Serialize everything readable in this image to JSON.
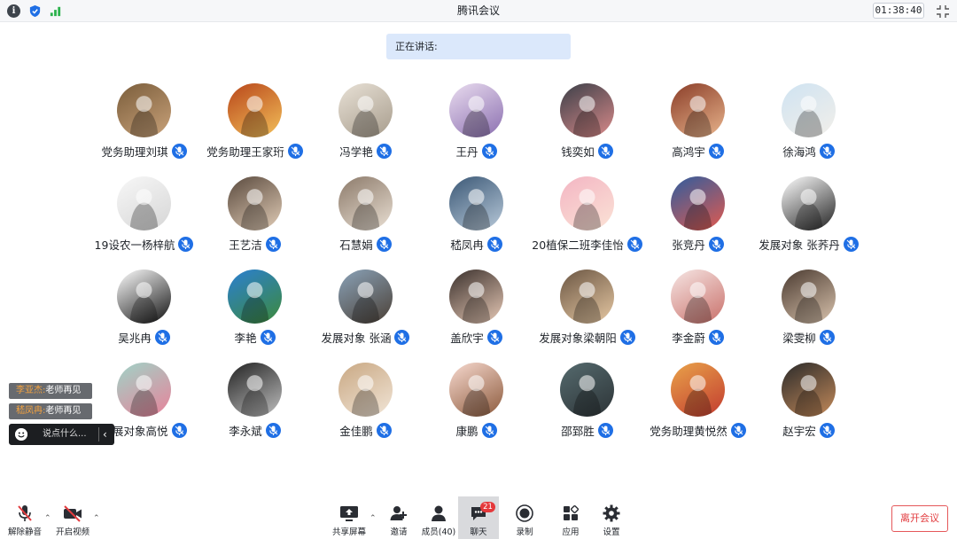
{
  "titlebar": {
    "title": "腾讯会议",
    "timer": "01:38:40",
    "icons": [
      "info-icon",
      "shield-icon",
      "signal-icon",
      "fullscreen-icon"
    ]
  },
  "speaking": {
    "label": "正在讲话:"
  },
  "participants": [
    {
      "name": "党务助理刘琪",
      "c1": "#7a5d3b",
      "c2": "#c9a27a"
    },
    {
      "name": "党务助理王家珩",
      "c1": "#b8461a",
      "c2": "#f3c05a"
    },
    {
      "name": "冯学艳",
      "c1": "#e8e1d6",
      "c2": "#a79c8c"
    },
    {
      "name": "王丹",
      "c1": "#e9dcef",
      "c2": "#8b6fb0"
    },
    {
      "name": "钱奕如",
      "c1": "#3b3f48",
      "c2": "#d98a8a"
    },
    {
      "name": "高鸿宇",
      "c1": "#8a3d28",
      "c2": "#e8b48c"
    },
    {
      "name": "徐海鸿",
      "c1": "#cfe3f2",
      "c2": "#f2efe9"
    },
    {
      "name": "19设农一杨梓航",
      "c1": "#f7f7f7",
      "c2": "#d6d6d6"
    },
    {
      "name": "王艺洁",
      "c1": "#5a4a3e",
      "c2": "#e1ccb6"
    },
    {
      "name": "石慧娟",
      "c1": "#8c7a6a",
      "c2": "#e9dfd3"
    },
    {
      "name": "嵇凤冉",
      "c1": "#3b5876",
      "c2": "#b8c9d9"
    },
    {
      "name": "20植保二班李佳怡",
      "c1": "#f3b5c3",
      "c2": "#fbe3d6"
    },
    {
      "name": "张竞丹",
      "c1": "#2f5d9e",
      "c2": "#e25a4f"
    },
    {
      "name": "发展对象 张荞丹",
      "c1": "#ffffff",
      "c2": "#222222"
    },
    {
      "name": "吴兆冉",
      "c1": "#ffffff",
      "c2": "#111111"
    },
    {
      "name": "李艳",
      "c1": "#2b7fd2",
      "c2": "#3d8a3a"
    },
    {
      "name": "发展对象 张涵",
      "c1": "#8aa2b8",
      "c2": "#4b4036"
    },
    {
      "name": "盖欣宇",
      "c1": "#3a302c",
      "c2": "#e7c9b6"
    },
    {
      "name": "发展对象梁朝阳",
      "c1": "#6b5643",
      "c2": "#e6c8a3"
    },
    {
      "name": "李金蔚",
      "c1": "#f6e6e4",
      "c2": "#c9706a"
    },
    {
      "name": "梁雯柳",
      "c1": "#4a3a30",
      "c2": "#d9c3ad"
    },
    {
      "name": "发展对象高悦",
      "c1": "#9fd3c7",
      "c2": "#e8829a"
    },
    {
      "name": "李永斌",
      "c1": "#222222",
      "c2": "#bfbfbf"
    },
    {
      "name": "金佳鹏",
      "c1": "#c9a883",
      "c2": "#f1e5d7"
    },
    {
      "name": "康鹏",
      "c1": "#f7d9cf",
      "c2": "#8c5a3c"
    },
    {
      "name": "邵郅胜",
      "c1": "#556a6e",
      "c2": "#2d3437"
    },
    {
      "name": "党务助理黄悦然",
      "c1": "#e9a34a",
      "c2": "#c23b2f"
    },
    {
      "name": "赵宇宏",
      "c1": "#2a2a2a",
      "c2": "#c48a5a"
    }
  ],
  "chat": {
    "messages": [
      {
        "sender": "李亚杰:",
        "text": "老师再见"
      },
      {
        "sender": "嵇凤冉:",
        "text": "老师再见"
      }
    ],
    "input_placeholder": "说点什么...",
    "collapse_glyph": "‹"
  },
  "toolbar": {
    "unmute": "解除静音",
    "video": "开启视频",
    "share": "共享屏幕",
    "invite": "邀请",
    "members": "成员(40)",
    "chat": "聊天",
    "chat_badge": "21",
    "record": "录制",
    "apps": "应用",
    "settings": "设置",
    "caret": "⌃"
  },
  "leave_button": "离开会议"
}
